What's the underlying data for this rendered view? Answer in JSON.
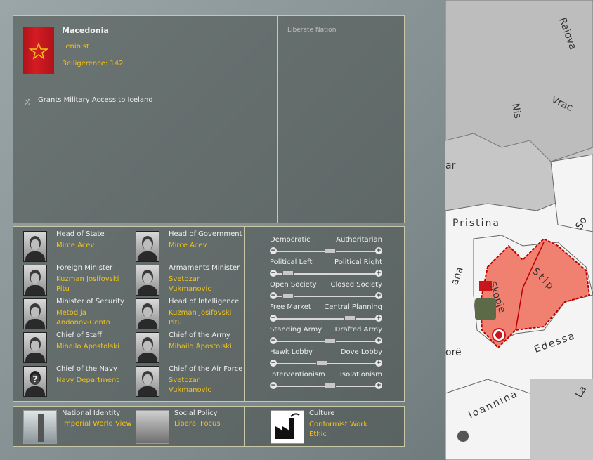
{
  "country": {
    "name": "Macedonia",
    "ideology": "Leninist",
    "belligerence": "Belligerence: 142",
    "access_text": "Grants Military Access to Iceland",
    "liberate_label": "Liberate Nation"
  },
  "cabinet": [
    {
      "role": "Head of State",
      "name": "Mirce Acev"
    },
    {
      "role": "Head of Government",
      "name": "Mirce Acev"
    },
    {
      "role": "Foreign Minister",
      "name": "Kuzman Josifovski Pitu"
    },
    {
      "role": "Armaments Minister",
      "name": "Svetozar Vukmanovic"
    },
    {
      "role": "Minister of Security",
      "name": "Metodija Andonov-Cento"
    },
    {
      "role": "Head of Intelligence",
      "name": "Kuzman Josifovski Pitu"
    },
    {
      "role": "Chief of Staff",
      "name": "Mihailo Apostolski"
    },
    {
      "role": "Chief of the Army",
      "name": "Mihailo Apostolski"
    },
    {
      "role": "Chief of the Navy",
      "name": "Navy Department"
    },
    {
      "role": "Chief of the Air Force",
      "name": "Svetozar Vukmanovic"
    }
  ],
  "sliders": [
    {
      "left": "Democratic",
      "right": "Authoritarian",
      "value": 0.55
    },
    {
      "left": "Political Left",
      "right": "Political Right",
      "value": 0.05
    },
    {
      "left": "Open Society",
      "right": "Closed Society",
      "value": 0.05
    },
    {
      "left": "Free Market",
      "right": "Central Planning",
      "value": 0.78
    },
    {
      "left": "Standing Army",
      "right": "Drafted Army",
      "value": 0.55
    },
    {
      "left": "Hawk Lobby",
      "right": "Dove Lobby",
      "value": 0.45
    },
    {
      "left": "Interventionism",
      "right": "Isolationism",
      "value": 0.55
    }
  ],
  "policies": [
    {
      "title": "National Identity",
      "value": "Imperial World View"
    },
    {
      "title": "Social Policy",
      "value": "Liberal Focus"
    },
    {
      "title": "Culture",
      "value": "Conformist Work Ethic"
    }
  ],
  "map_labels": {
    "a": "Raiova",
    "b": "Nis",
    "c": "Vrac",
    "d": "ar",
    "e": "Pristina",
    "f": "So",
    "g": "Skopje",
    "h": "Stip",
    "i": "ana",
    "j": "orë",
    "k": "Edessa",
    "l": "Ioannina",
    "m": "La"
  },
  "colors": {
    "accent": "#f1c31a",
    "flag": "#c8161c",
    "border": "#c8c8a8",
    "map_owned": "#f08070"
  }
}
